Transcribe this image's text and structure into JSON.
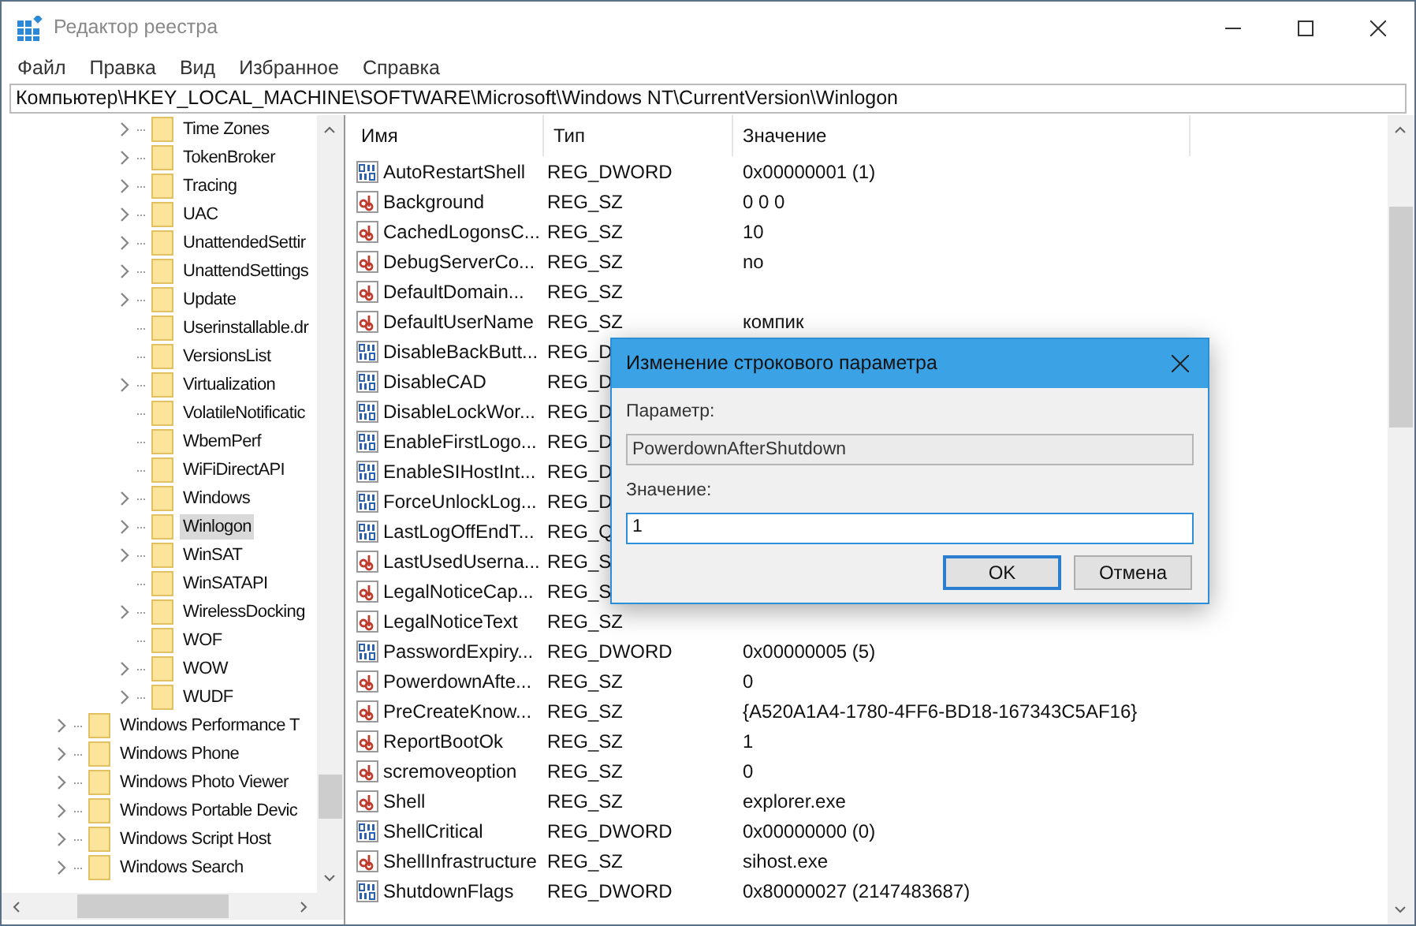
{
  "window": {
    "title": "Редактор реестра"
  },
  "menu": [
    "Файл",
    "Правка",
    "Вид",
    "Избранное",
    "Справка"
  ],
  "address": "Компьютер\\HKEY_LOCAL_MACHINE\\SOFTWARE\\Microsoft\\Windows NT\\CurrentVersion\\Winlogon",
  "tree": {
    "items": [
      {
        "children": [
          {
            "label": "Time Zones",
            "expandable": true,
            "selected": false
          },
          {
            "label": "TokenBroker",
            "expandable": true,
            "selected": false
          },
          {
            "label": "Tracing",
            "expandable": true,
            "selected": false
          },
          {
            "label": "UAC",
            "expandable": true,
            "selected": false
          },
          {
            "label": "UnattendedSettir",
            "expandable": true,
            "selected": false
          },
          {
            "label": "UnattendSettings",
            "expandable": true,
            "selected": false
          },
          {
            "label": "Update",
            "expandable": true,
            "selected": false
          },
          {
            "label": "Userinstallable.dr",
            "expandable": false,
            "selected": false
          },
          {
            "label": "VersionsList",
            "expandable": false,
            "selected": false
          },
          {
            "label": "Virtualization",
            "expandable": true,
            "selected": false
          },
          {
            "label": "VolatileNotificatic",
            "expandable": false,
            "selected": false
          },
          {
            "label": "WbemPerf",
            "expandable": false,
            "selected": false
          },
          {
            "label": "WiFiDirectAPI",
            "expandable": false,
            "selected": false
          },
          {
            "label": "Windows",
            "expandable": true,
            "selected": false
          },
          {
            "label": "Winlogon",
            "expandable": true,
            "selected": true
          },
          {
            "label": "WinSAT",
            "expandable": true,
            "selected": false
          },
          {
            "label": "WinSATAPI",
            "expandable": false,
            "selected": false
          },
          {
            "label": "WirelessDocking",
            "expandable": true,
            "selected": false
          },
          {
            "label": "WOF",
            "expandable": false,
            "selected": false
          },
          {
            "label": "WOW",
            "expandable": true,
            "selected": false
          },
          {
            "label": "WUDF",
            "expandable": true,
            "selected": false
          }
        ]
      },
      {
        "label": "Windows Performance T",
        "expandable": true,
        "selected": false
      },
      {
        "label": "Windows Phone",
        "expandable": true,
        "selected": false
      },
      {
        "label": "Windows Photo Viewer",
        "expandable": true,
        "selected": false
      },
      {
        "label": "Windows Portable Devic",
        "expandable": true,
        "selected": false
      },
      {
        "label": "Windows Script Host",
        "expandable": true,
        "selected": false
      },
      {
        "label": "Windows Search",
        "expandable": true,
        "selected": false
      }
    ]
  },
  "table": {
    "columns": [
      "Имя",
      "Тип",
      "Значение"
    ],
    "rows": [
      {
        "kind": "binary",
        "name": "AutoRestartShell",
        "type": "REG_DWORD",
        "value": "0x00000001 (1)"
      },
      {
        "kind": "string",
        "name": "Background",
        "type": "REG_SZ",
        "value": "0 0 0"
      },
      {
        "kind": "string",
        "name": "CachedLogonsC...",
        "type": "REG_SZ",
        "value": "10"
      },
      {
        "kind": "string",
        "name": "DebugServerCo...",
        "type": "REG_SZ",
        "value": "no"
      },
      {
        "kind": "string",
        "name": "DefaultDomain...",
        "type": "REG_SZ"
      },
      {
        "kind": "string",
        "name": "DefaultUserName",
        "type": "REG_SZ",
        "value": "компик"
      },
      {
        "kind": "binary",
        "name": "DisableBackButt...",
        "type": "REG_D"
      },
      {
        "kind": "binary",
        "name": "DisableCAD",
        "type": "REG_D"
      },
      {
        "kind": "binary",
        "name": "DisableLockWor...",
        "type": "REG_D"
      },
      {
        "kind": "binary",
        "name": "EnableFirstLogo...",
        "type": "REG_D"
      },
      {
        "kind": "binary",
        "name": "EnableSIHostInt...",
        "type": "REG_D"
      },
      {
        "kind": "binary",
        "name": "ForceUnlockLog...",
        "type": "REG_D"
      },
      {
        "kind": "binary",
        "name": "LastLogOffEndT...",
        "type": "REG_Q"
      },
      {
        "kind": "string",
        "name": "LastUsedUserna...",
        "type": "REG_S"
      },
      {
        "kind": "string",
        "name": "LegalNoticeCap...",
        "type": "REG_S"
      },
      {
        "kind": "string",
        "name": "LegalNoticeText",
        "type": "REG_SZ"
      },
      {
        "kind": "binary",
        "name": "PasswordExpiry...",
        "type": "REG_DWORD",
        "value": "0x00000005 (5)"
      },
      {
        "kind": "string",
        "name": "PowerdownAfte...",
        "type": "REG_SZ",
        "value": "0"
      },
      {
        "kind": "string",
        "name": "PreCreateKnow...",
        "type": "REG_SZ",
        "value": "{A520A1A4-1780-4FF6-BD18-167343C5AF16}"
      },
      {
        "kind": "string",
        "name": "ReportBootOk",
        "type": "REG_SZ",
        "value": "1"
      },
      {
        "kind": "string",
        "name": "scremoveoption",
        "type": "REG_SZ",
        "value": "0"
      },
      {
        "kind": "string",
        "name": "Shell",
        "type": "REG_SZ",
        "value": "explorer.exe"
      },
      {
        "kind": "binary",
        "name": "ShellCritical",
        "type": "REG_DWORD",
        "value": "0x00000000 (0)"
      },
      {
        "kind": "string",
        "name": "ShellInfrastructure",
        "type": "REG_SZ",
        "value": "sihost.exe"
      },
      {
        "kind": "binary",
        "name": "ShutdownFlags",
        "type": "REG_DWORD",
        "value": "0x80000027 (2147483687)"
      }
    ]
  },
  "dialog": {
    "title": "Изменение строкового параметра",
    "name_label": "Параметр:",
    "name_value": "PowerdownAfterShutdown",
    "value_label": "Значение:",
    "value": "1",
    "buttons": [
      {
        "label": "OK",
        "default": true
      },
      {
        "label": "Отмена",
        "default": false
      }
    ]
  }
}
